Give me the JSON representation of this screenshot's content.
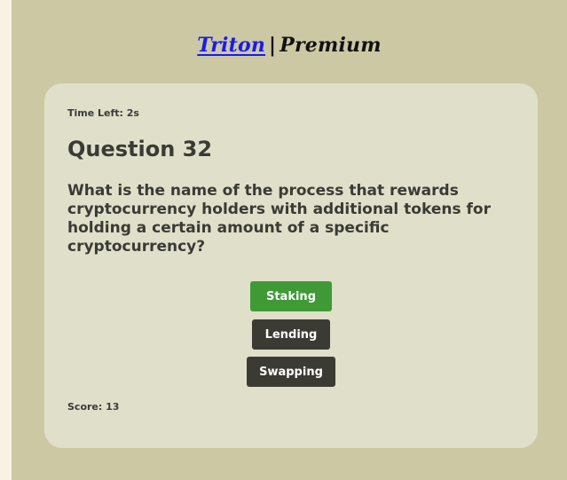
{
  "header": {
    "brand_link": "Triton",
    "separator": "|",
    "tier": "Premium"
  },
  "quiz": {
    "time_left": "Time Left: 2s",
    "question_title": "Question 32",
    "question_text": "What is the name of the process that rewards cryptocurrency holders with additional tokens for holding a certain amount of a specific cryptocurrency?",
    "answers": [
      {
        "label": "Staking",
        "state": "correct"
      },
      {
        "label": "Lending",
        "state": "default"
      },
      {
        "label": "Swapping",
        "state": "default"
      }
    ],
    "score": "Score: 13"
  },
  "colors": {
    "page_background": "#f8f2e2",
    "frame_background": "#cbc8a3",
    "card_background": "#e0dfca",
    "correct_button": "#3f9a35",
    "default_button": "#3c3b33",
    "brand_link": "#1a1af0"
  }
}
